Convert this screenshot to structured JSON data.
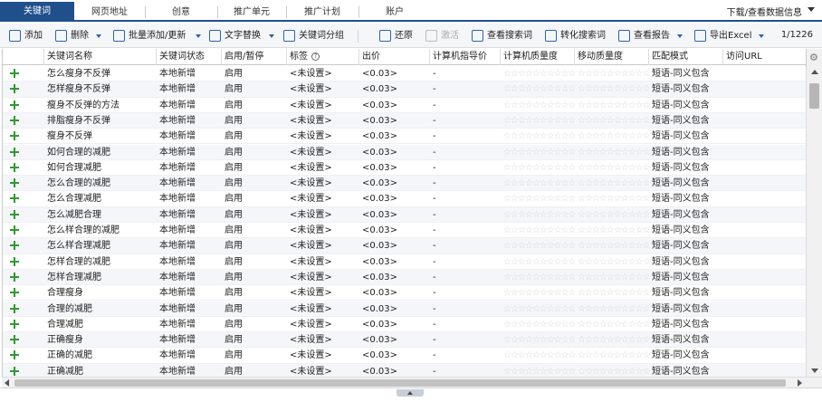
{
  "tabs": [
    {
      "label": "关键词",
      "active": true
    },
    {
      "label": "网页地址",
      "active": false
    },
    {
      "label": "创意",
      "active": false
    },
    {
      "label": "推广单元",
      "active": false
    },
    {
      "label": "推广计划",
      "active": false
    },
    {
      "label": "账户",
      "active": false
    }
  ],
  "download_label": "下载/查看数据信息",
  "toolbar": {
    "add": "添加",
    "delete": "删除",
    "batch_add": "批量添加/更新",
    "text_replace": "文字替换",
    "group": "关键词分组",
    "restore": "还原",
    "activate": "激活",
    "view_search_terms": "查看搜索词",
    "convert_search_terms": "转化搜索词",
    "view_report": "查看报告",
    "export": "导出Excel",
    "page_count": "1/1226"
  },
  "columns": {
    "name": "关键词名称",
    "status": "关键词状态",
    "enable": "启用/暂停",
    "tag": "标签",
    "bid": "出价",
    "pc_bid_guide": "计算机指导价",
    "pc_quality": "计算机质量度",
    "mobile_quality": "移动质量度",
    "match": "匹配模式",
    "url": "访问URL"
  },
  "rows": [
    {
      "name": "怎么瘦身不反弹",
      "status": "本地新增",
      "enable": "启用",
      "tag": "<未设置>",
      "bid": "<0.03>",
      "guide": "-",
      "pc_q": "0",
      "m_q": "0",
      "match": "短语-同义包含"
    },
    {
      "name": "怎样瘦身不反弹",
      "status": "本地新增",
      "enable": "启用",
      "tag": "<未设置>",
      "bid": "<0.03>",
      "guide": "-",
      "pc_q": "0",
      "m_q": "0",
      "match": "短语-同义包含"
    },
    {
      "name": "瘦身不反弹的方法",
      "status": "本地新增",
      "enable": "启用",
      "tag": "<未设置>",
      "bid": "<0.03>",
      "guide": "-",
      "pc_q": "0",
      "m_q": "0",
      "match": "短语-同义包含"
    },
    {
      "name": "排脂瘦身不反弹",
      "status": "本地新增",
      "enable": "启用",
      "tag": "<未设置>",
      "bid": "<0.03>",
      "guide": "-",
      "pc_q": "0",
      "m_q": "0",
      "match": "短语-同义包含"
    },
    {
      "name": "瘦身不反弹",
      "status": "本地新增",
      "enable": "启用",
      "tag": "<未设置>",
      "bid": "<0.03>",
      "guide": "-",
      "pc_q": "0",
      "m_q": "0",
      "match": "短语-同义包含"
    },
    {
      "name": "如何合理的减肥",
      "status": "本地新增",
      "enable": "启用",
      "tag": "<未设置>",
      "bid": "<0.03>",
      "guide": "-",
      "pc_q": "0",
      "m_q": "0",
      "match": "短语-同义包含"
    },
    {
      "name": "如何合理减肥",
      "status": "本地新增",
      "enable": "启用",
      "tag": "<未设置>",
      "bid": "<0.03>",
      "guide": "-",
      "pc_q": "0",
      "m_q": "0",
      "match": "短语-同义包含"
    },
    {
      "name": "怎么合理的减肥",
      "status": "本地新增",
      "enable": "启用",
      "tag": "<未设置>",
      "bid": "<0.03>",
      "guide": "-",
      "pc_q": "0",
      "m_q": "0",
      "match": "短语-同义包含"
    },
    {
      "name": "怎么合理减肥",
      "status": "本地新增",
      "enable": "启用",
      "tag": "<未设置>",
      "bid": "<0.03>",
      "guide": "-",
      "pc_q": "0",
      "m_q": "0",
      "match": "短语-同义包含"
    },
    {
      "name": "怎么减肥合理",
      "status": "本地新增",
      "enable": "启用",
      "tag": "<未设置>",
      "bid": "<0.03>",
      "guide": "-",
      "pc_q": "0",
      "m_q": "0",
      "match": "短语-同义包含"
    },
    {
      "name": "怎么样合理的减肥",
      "status": "本地新增",
      "enable": "启用",
      "tag": "<未设置>",
      "bid": "<0.03>",
      "guide": "-",
      "pc_q": "0",
      "m_q": "0",
      "match": "短语-同义包含"
    },
    {
      "name": "怎么样合理减肥",
      "status": "本地新增",
      "enable": "启用",
      "tag": "<未设置>",
      "bid": "<0.03>",
      "guide": "-",
      "pc_q": "0",
      "m_q": "0",
      "match": "短语-同义包含"
    },
    {
      "name": "怎样合理的减肥",
      "status": "本地新增",
      "enable": "启用",
      "tag": "<未设置>",
      "bid": "<0.03>",
      "guide": "-",
      "pc_q": "0",
      "m_q": "0",
      "match": "短语-同义包含"
    },
    {
      "name": "怎样合理减肥",
      "status": "本地新增",
      "enable": "启用",
      "tag": "<未设置>",
      "bid": "<0.03>",
      "guide": "-",
      "pc_q": "0",
      "m_q": "0",
      "match": "短语-同义包含"
    },
    {
      "name": "合理瘦身",
      "status": "本地新增",
      "enable": "启用",
      "tag": "<未设置>",
      "bid": "<0.03>",
      "guide": "-",
      "pc_q": "0",
      "m_q": "0",
      "match": "短语-同义包含"
    },
    {
      "name": "合理的减肥",
      "status": "本地新增",
      "enable": "启用",
      "tag": "<未设置>",
      "bid": "<0.03>",
      "guide": "-",
      "pc_q": "0",
      "m_q": "0",
      "match": "短语-同义包含"
    },
    {
      "name": "合理减肥",
      "status": "本地新增",
      "enable": "启用",
      "tag": "<未设置>",
      "bid": "<0.03>",
      "guide": "-",
      "pc_q": "0",
      "m_q": "0",
      "match": "短语-同义包含"
    },
    {
      "name": "正确瘦身",
      "status": "本地新增",
      "enable": "启用",
      "tag": "<未设置>",
      "bid": "<0.03>",
      "guide": "-",
      "pc_q": "0",
      "m_q": "0",
      "match": "短语-同义包含"
    },
    {
      "name": "正确的减肥",
      "status": "本地新增",
      "enable": "启用",
      "tag": "<未设置>",
      "bid": "<0.03>",
      "guide": "-",
      "pc_q": "0",
      "m_q": "0",
      "match": "短语-同义包含"
    },
    {
      "name": "正确减肥",
      "status": "本地新增",
      "enable": "启用",
      "tag": "<未设置>",
      "bid": "<0.03>",
      "guide": "-",
      "pc_q": "0",
      "m_q": "0",
      "match": "短语-同义包含"
    }
  ],
  "colors": {
    "accent": "#20508c",
    "plus": "#2f9a2f",
    "zero": "#e02020"
  }
}
